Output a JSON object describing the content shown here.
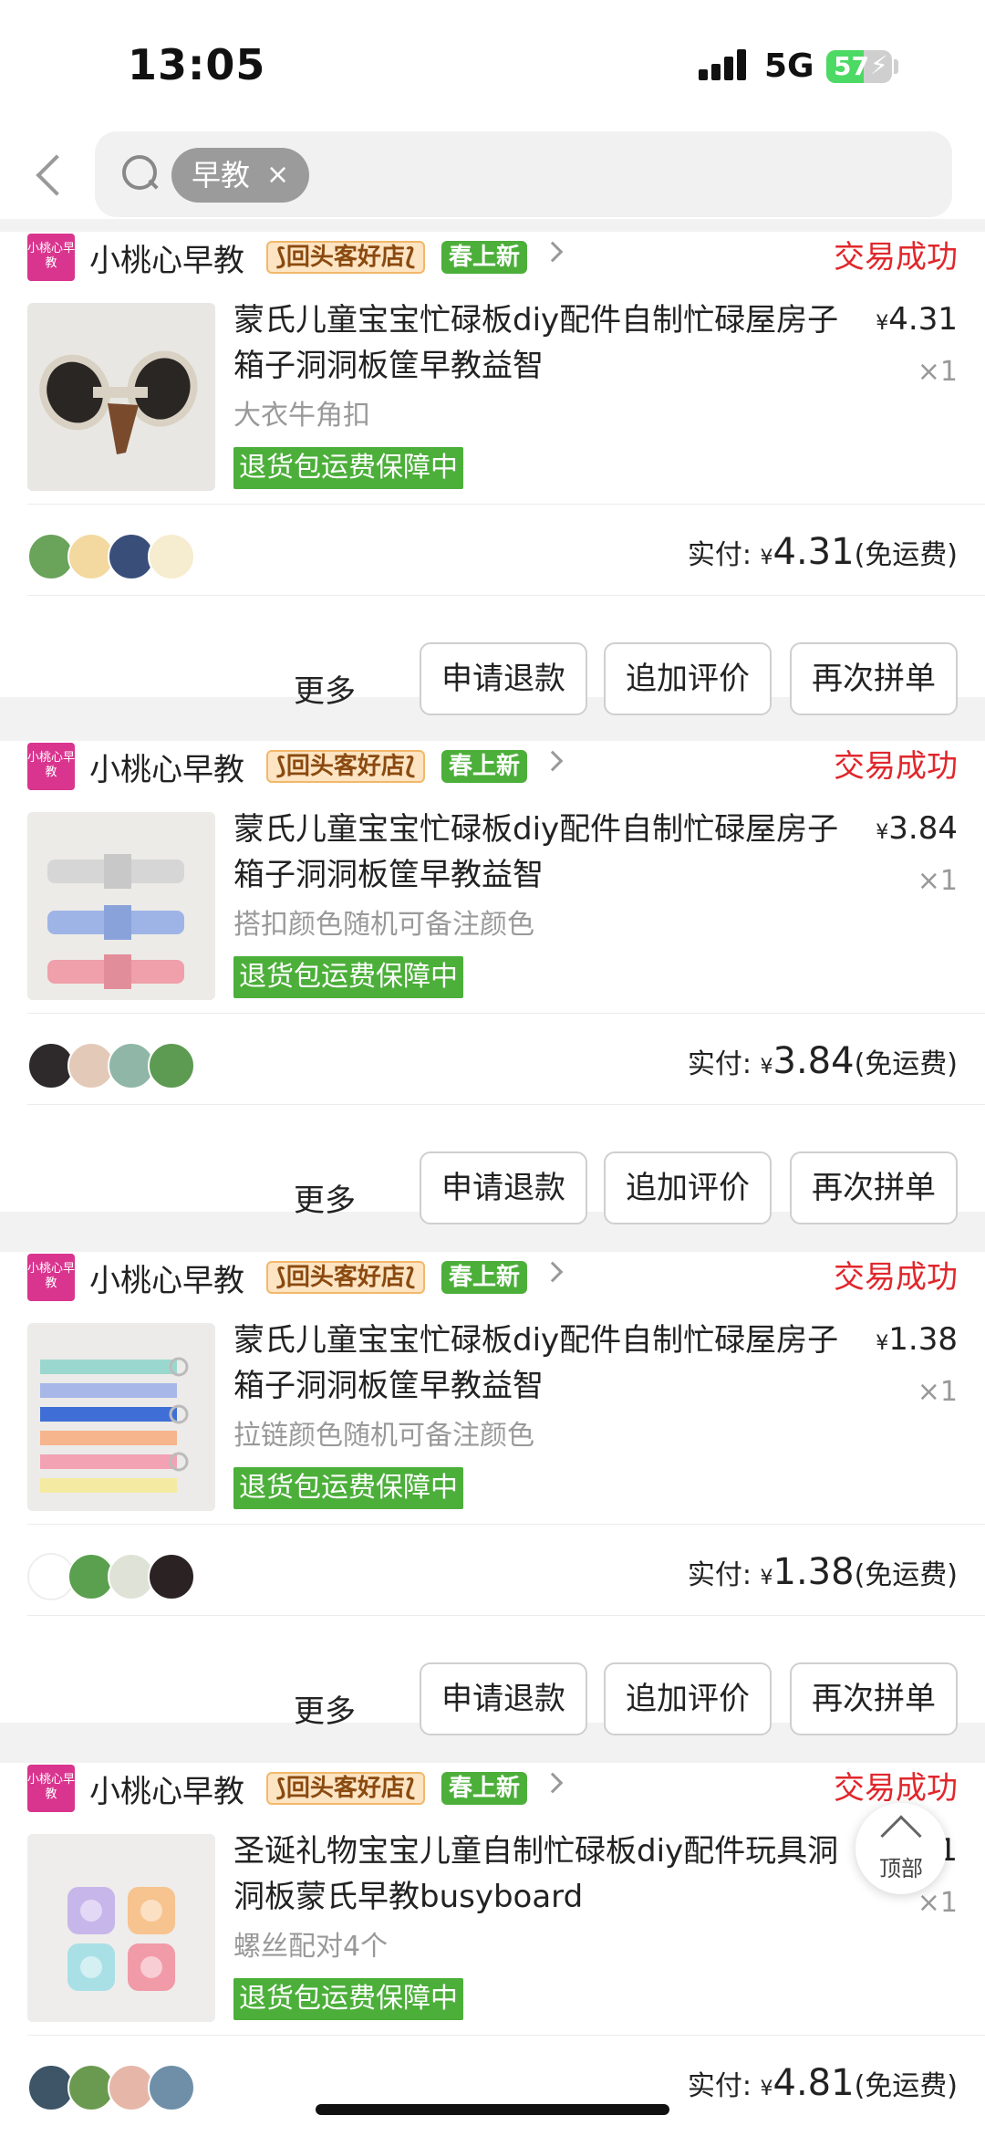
{
  "status_bar": {
    "time": "13:05",
    "network": "5G",
    "battery": "57"
  },
  "search": {
    "chip": "早教",
    "chip_remove": "×"
  },
  "orders": [
    {
      "shop_logo": "小桃心早教",
      "shop_name": "小桃心早教",
      "tag_repeat": "⟆回头客好店⟅",
      "tag_new": "春上新",
      "status": "交易成功",
      "title": "蒙氏儿童宝宝忙碌板diy配件自制忙碌屋房子箱子洞洞板筐早教益智",
      "spec": "大衣牛角扣",
      "price": "4.31",
      "qty": "×1",
      "guarantee": "退货包运费保障中",
      "paid_label": "实付:",
      "paid_amount": "4.31",
      "shipping": "(免运费)",
      "btn_more": "更多",
      "btn_refund": "申请退款",
      "btn_review": "追加评价",
      "btn_rebuy": "再次拼单"
    },
    {
      "shop_logo": "小桃心早教",
      "shop_name": "小桃心早教",
      "tag_repeat": "⟆回头客好店⟅",
      "tag_new": "春上新",
      "status": "交易成功",
      "title": "蒙氏儿童宝宝忙碌板diy配件自制忙碌屋房子箱子洞洞板筐早教益智",
      "spec": "搭扣颜色随机可备注颜色",
      "price": "3.84",
      "qty": "×1",
      "guarantee": "退货包运费保障中",
      "paid_label": "实付:",
      "paid_amount": "3.84",
      "shipping": "(免运费)",
      "btn_more": "更多",
      "btn_refund": "申请退款",
      "btn_review": "追加评价",
      "btn_rebuy": "再次拼单"
    },
    {
      "shop_logo": "小桃心早教",
      "shop_name": "小桃心早教",
      "tag_repeat": "⟆回头客好店⟅",
      "tag_new": "春上新",
      "status": "交易成功",
      "title": "蒙氏儿童宝宝忙碌板diy配件自制忙碌屋房子箱子洞洞板筐早教益智",
      "spec": "拉链颜色随机可备注颜色",
      "price": "1.38",
      "qty": "×1",
      "guarantee": "退货包运费保障中",
      "paid_label": "实付:",
      "paid_amount": "1.38",
      "shipping": "(免运费)",
      "btn_more": "更多",
      "btn_refund": "申请退款",
      "btn_review": "追加评价",
      "btn_rebuy": "再次拼单"
    },
    {
      "shop_logo": "小桃心早教",
      "shop_name": "小桃心早教",
      "tag_repeat": "⟆回头客好店⟅",
      "tag_new": "春上新",
      "status": "交易成功",
      "title": "圣诞礼物宝宝儿童自制忙碌板diy配件玩具洞洞板蒙氏早教busyboard",
      "spec": "螺丝配对4个",
      "price": "1",
      "qty": "×1",
      "guarantee": "退货包运费保障中",
      "paid_label": "实付:",
      "paid_amount": "4.81",
      "shipping": "(免运费)"
    }
  ],
  "top_button": "顶部",
  "colors": {
    "status_red": "#e0272c",
    "green_tag": "#4caf3a",
    "shop_logo": "#d9358f"
  }
}
